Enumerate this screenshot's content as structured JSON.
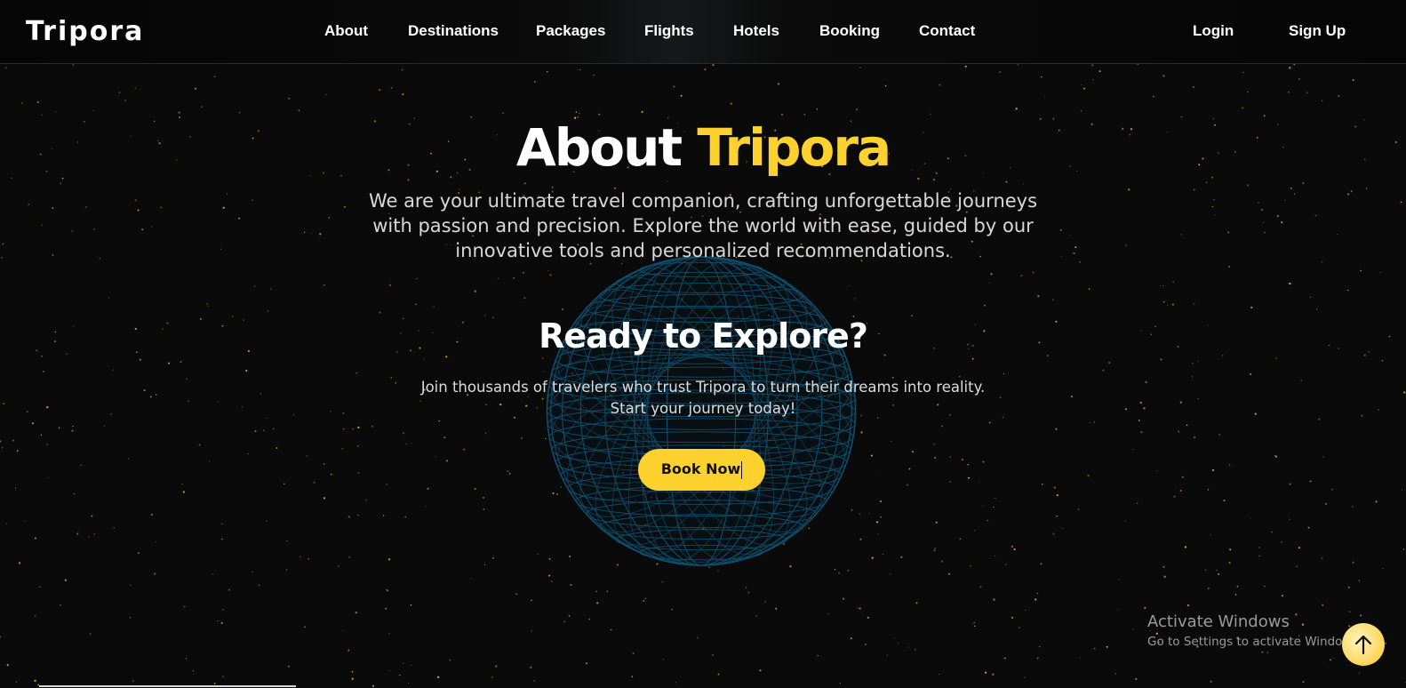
{
  "brand": "Tripora",
  "nav": {
    "links": [
      "About",
      "Destinations",
      "Packages",
      "Flights",
      "Hotels",
      "Booking",
      "Contact"
    ],
    "login": "Login",
    "signup": "Sign Up"
  },
  "hero": {
    "title_white": "About",
    "title_accent": "Tripora",
    "description": "We are your ultimate travel companion, crafting unforgettable journeys with passion and precision. Explore the world with ease, guided by our innovative tools and personalized recommendations."
  },
  "cta": {
    "title": "Ready to Explore?",
    "description": "Join thousands of travelers who trust Tripora to turn their dreams into reality. Start your journey today!",
    "button": "Book Now"
  },
  "watermark": {
    "line1": "Activate Windows",
    "line2": "Go to Settings to activate Windows."
  },
  "colors": {
    "background": "#0a0a0b",
    "accent": "#fdd22f",
    "globe": "#0e4f6e",
    "star": "#d6b52a"
  },
  "icons": {
    "scroll_top": "arrow-up-icon"
  }
}
